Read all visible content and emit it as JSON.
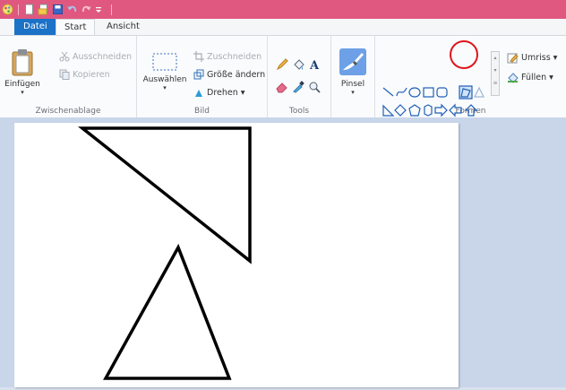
{
  "quick_access": {
    "icons": [
      "app-icon",
      "new-icon",
      "open-icon",
      "save-icon",
      "undo-icon",
      "redo-icon",
      "customize-icon"
    ]
  },
  "tabs": [
    {
      "label": "Datei"
    },
    {
      "label": "Start"
    },
    {
      "label": "Ansicht"
    }
  ],
  "clipboard": {
    "paste_label": "Einfügen",
    "cut_label": "Ausschneiden",
    "copy_label": "Kopieren",
    "group_label": "Zwischenablage"
  },
  "image": {
    "select_label": "Auswählen",
    "crop_label": "Zuschneiden",
    "resize_label": "Größe ändern",
    "rotate_label": "Drehen ▾",
    "group_label": "Bild"
  },
  "tools": {
    "group_label": "Tools",
    "brush_label": "Pinsel"
  },
  "shapes": {
    "group_label": "Formen",
    "outline_label": "Umriss ▾",
    "fill_label": "Füllen ▾"
  },
  "colors": {
    "title_bar": "#e0587f",
    "file_tab": "#1b72c6",
    "highlight": "#e0141b",
    "shape_outline": "#1f5fb8"
  }
}
